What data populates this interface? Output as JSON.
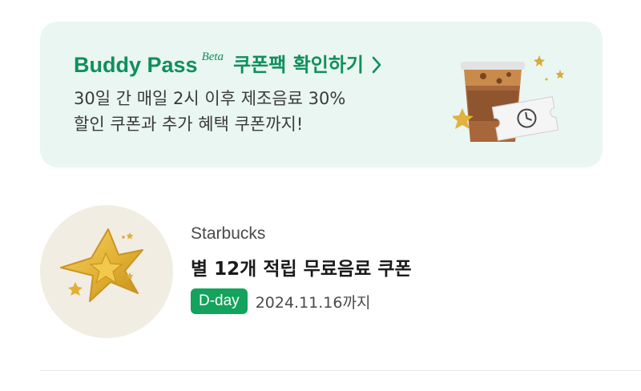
{
  "banner": {
    "title": "Buddy Pass",
    "beta_label": "Beta",
    "cta_label": "쿠폰팩 확인하기",
    "description_line1": "30일 간 매일 2시 이후 제조음료 30%",
    "description_line2": "할인 쿠폰과 추가 혜택 쿠폰까지!",
    "icon": "coffee-cup-with-ticket-illustration"
  },
  "coupon": {
    "brand": "Starbucks",
    "title": "별 12개 적립 무료음료 쿠폰",
    "badge": "D-day",
    "expiry": "2024.11.16까지",
    "icon": "gold-star-illustration"
  },
  "colors": {
    "brand_green": "#0f8f5d",
    "badge_green": "#13a35c",
    "banner_bg": "#eaf6f1",
    "thumb_bg": "#f1ede3"
  }
}
